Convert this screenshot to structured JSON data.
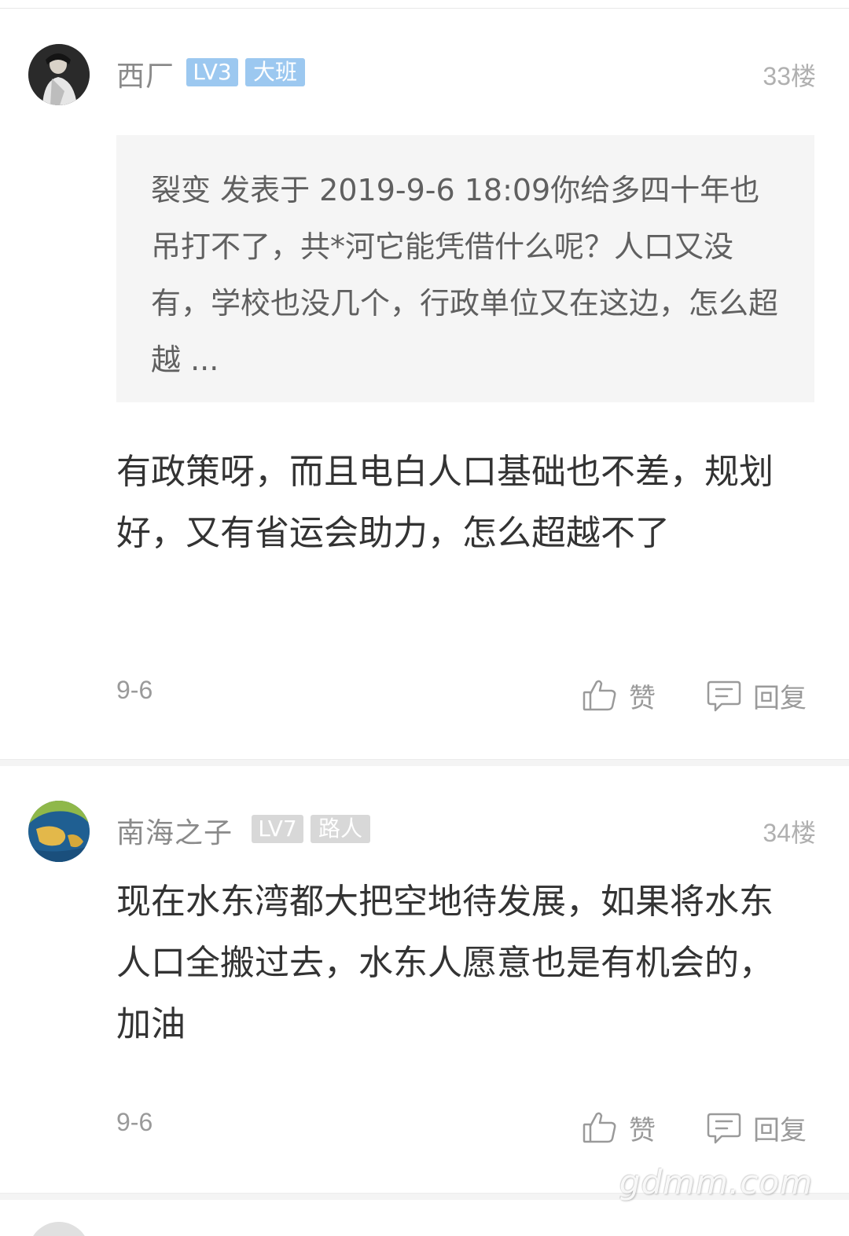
{
  "posts": [
    {
      "username": "西厂",
      "level_badge": "LV3",
      "title_badge": "大班",
      "floor": "33楼",
      "quote": "裂变 发表于 2019-9-6 18:09你给多四十年也吊打不了，共*河它能凭借什么呢？人口又没有，学校也没几个，行政单位又在这边，怎么超越 ...",
      "content": "有政策呀，而且电白人口基础也不差，规划好，又有省运会助力，怎么超越不了",
      "date": "9-6",
      "like_label": "赞",
      "reply_label": "回复"
    },
    {
      "username": "南海之子",
      "level_badge": "LV7",
      "title_badge": "路人",
      "floor": "34楼",
      "content": "现在水东湾都大把空地待发展，如果将水东人口全搬过去，水东人愿意也是有机会的，加油",
      "date": "9-6",
      "like_label": "赞",
      "reply_label": "回复"
    }
  ],
  "watermark": "gdmm.com",
  "colors": {
    "badge_active": "#9cc8f0",
    "badge_muted": "#d8d8d8",
    "quote_bg": "#f5f5f5",
    "meta_text": "#9a9a9a"
  },
  "icons": {
    "like": "thumbs-up-icon",
    "reply": "comment-icon"
  }
}
